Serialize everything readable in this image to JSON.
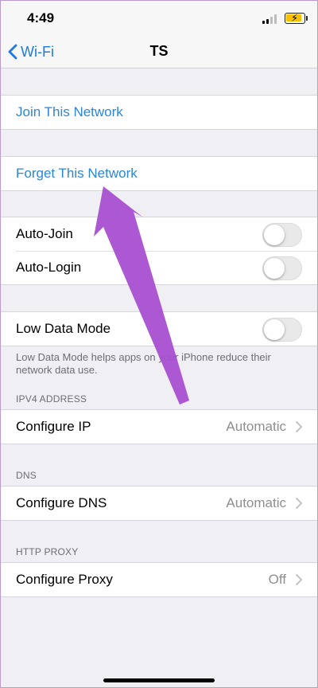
{
  "status": {
    "time": "4:49"
  },
  "nav": {
    "back_label": "Wi-Fi",
    "title": "TS"
  },
  "actions": {
    "join": "Join This Network",
    "forget": "Forget This Network"
  },
  "toggles": {
    "auto_join": {
      "label": "Auto-Join",
      "on": false
    },
    "auto_login": {
      "label": "Auto-Login",
      "on": false
    },
    "low_data": {
      "label": "Low Data Mode",
      "on": false
    }
  },
  "low_data_note": "Low Data Mode helps apps on your iPhone reduce their network data use.",
  "ipv4": {
    "header": "IPV4 ADDRESS",
    "label": "Configure IP",
    "value": "Automatic"
  },
  "dns": {
    "header": "DNS",
    "label": "Configure DNS",
    "value": "Automatic"
  },
  "proxy": {
    "header": "HTTP PROXY",
    "label": "Configure Proxy",
    "value": "Off"
  },
  "colors": {
    "link": "#2b86d6",
    "annotation_arrow": "#a64fd0"
  }
}
